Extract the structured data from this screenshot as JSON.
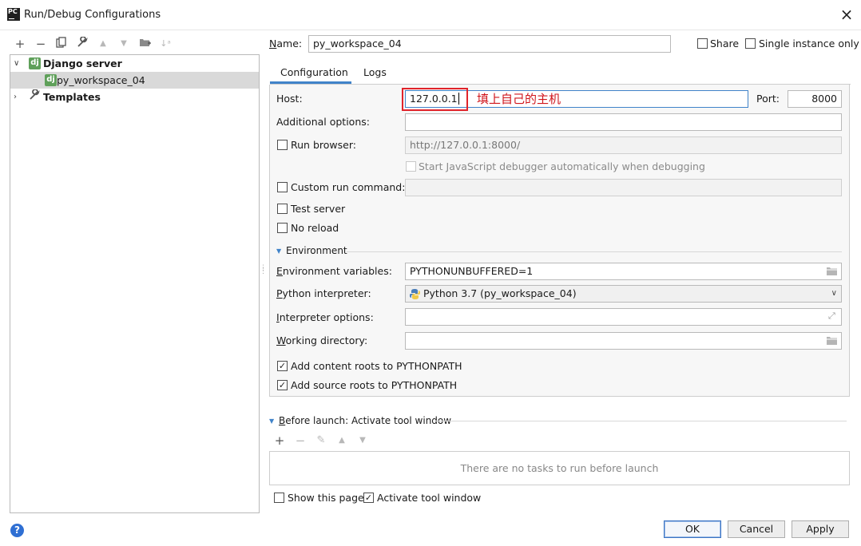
{
  "window": {
    "icon_text": "PC",
    "title": "Run/Debug Configurations"
  },
  "tree": {
    "groups": [
      {
        "label": "Django server",
        "expanded": true,
        "badge": "dj"
      },
      {
        "label": "Templates",
        "expanded": false
      }
    ],
    "selected_item": {
      "label": "py_workspace_04",
      "badge": "dj"
    }
  },
  "header": {
    "name_label": "Name:",
    "name_value": "py_workspace_04",
    "share_label": "Share",
    "share_checked": false,
    "single_instance_label": "Single instance only",
    "single_instance_checked": false
  },
  "tabs": [
    {
      "label": "Configuration",
      "active": true
    },
    {
      "label": "Logs",
      "active": false
    }
  ],
  "config": {
    "host_label": "Host:",
    "host_value": "127.0.0.1",
    "host_annotation": "填上自己的主机",
    "port_label": "Port:",
    "port_value": "8000",
    "additional_options_label": "Additional options:",
    "additional_options_value": "",
    "run_browser_label": "Run browser:",
    "run_browser_checked": false,
    "run_browser_url": "http://127.0.0.1:8000/",
    "js_debugger_label": "Start JavaScript debugger automatically when debugging",
    "js_debugger_checked": false,
    "custom_run_label": "Custom run command:",
    "custom_run_checked": false,
    "test_server_label": "Test server",
    "test_server_checked": false,
    "no_reload_label": "No reload",
    "no_reload_checked": false
  },
  "environment": {
    "section_label": "Environment",
    "env_vars_label": "Environment variables:",
    "env_vars_value": "PYTHONUNBUFFERED=1",
    "interpreter_label": "Python interpreter:",
    "interpreter_value": "Python 3.7 (py_workspace_04)",
    "interpreter_options_label": "Interpreter options:",
    "interpreter_options_value": "",
    "working_dir_label": "Working directory:",
    "working_dir_value": "",
    "add_content_roots_label": "Add content roots to PYTHONPATH",
    "add_content_roots_checked": true,
    "add_source_roots_label": "Add source roots to PYTHONPATH",
    "add_source_roots_checked": true
  },
  "before_launch": {
    "section_label": "Before launch: Activate tool window",
    "empty_text": "There are no tasks to run before launch",
    "show_page_label": "Show this page",
    "show_page_checked": false,
    "activate_tool_label": "Activate tool window",
    "activate_tool_checked": true
  },
  "buttons": {
    "ok": "OK",
    "cancel": "Cancel",
    "apply": "Apply",
    "help": "?"
  },
  "colors": {
    "accent": "#4083c9",
    "annotation_red": "#d0161c",
    "django_green": "#5fa05a"
  }
}
